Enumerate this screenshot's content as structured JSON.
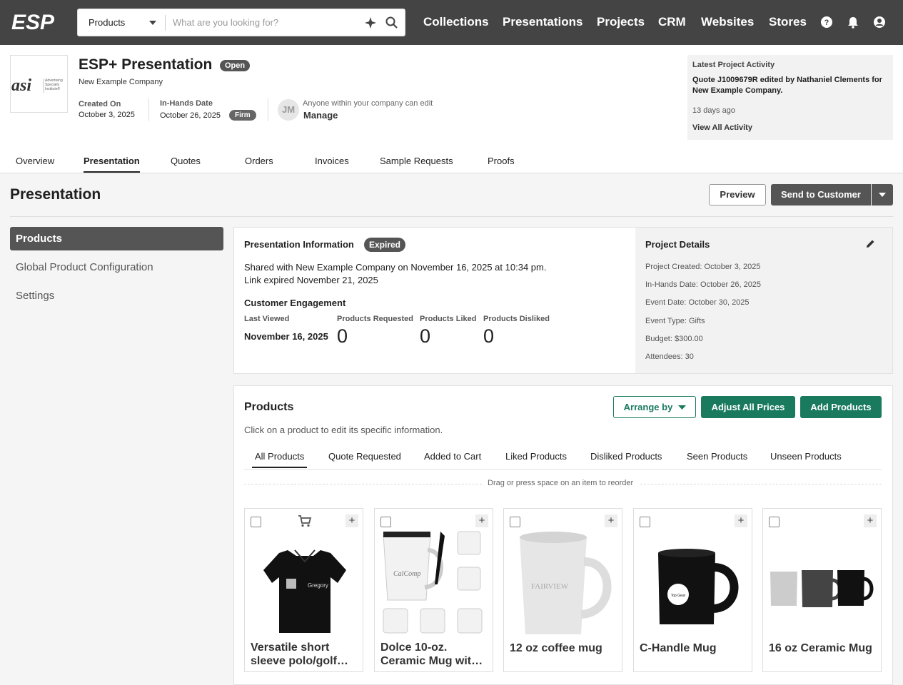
{
  "topbar": {
    "logo_text": "ESP",
    "search_scope": "Products",
    "search_placeholder": "What are you looking for?",
    "nav": [
      "Collections",
      "Presentations",
      "Projects",
      "CRM",
      "Websites",
      "Stores"
    ]
  },
  "project": {
    "title": "ESP+ Presentation",
    "status": "Open",
    "company": "New Example Company",
    "created_label": "Created On",
    "created_value": "October 3, 2025",
    "inhands_label": "In-Hands Date",
    "inhands_value": "October 26, 2025",
    "inhands_badge": "Firm",
    "avatar_initials": "JM",
    "access_note": "Anyone within your company can edit",
    "manage_label": "Manage"
  },
  "activity": {
    "title": "Latest Project Activity",
    "text": "Quote J1009679R edited by Nathaniel Clements for New Example Company.",
    "when": "13 days ago",
    "link": "View All Activity"
  },
  "tabs": [
    "Overview",
    "Presentation",
    "Quotes",
    "Orders",
    "Invoices",
    "Sample Requests",
    "Proofs"
  ],
  "page": {
    "title": "Presentation",
    "preview_label": "Preview",
    "send_label": "Send to Customer"
  },
  "sidebar": [
    "Products",
    "Global Product Configuration",
    "Settings"
  ],
  "info": {
    "title": "Presentation Information",
    "badge": "Expired",
    "shared": "Shared with New Example Company on November 16, 2025 at 10:34 pm.",
    "expired": "Link expired November 21, 2025",
    "engagement_title": "Customer Engagement",
    "last_viewed_label": "Last Viewed",
    "last_viewed_value": "November 16, 2025",
    "requested_label": "Products Requested",
    "requested_value": "0",
    "liked_label": "Products Liked",
    "liked_value": "0",
    "disliked_label": "Products Disliked",
    "disliked_value": "0"
  },
  "details": {
    "title": "Project Details",
    "items": [
      "Project Created: October 3, 2025",
      "In-Hands Date: October 26, 2025",
      "Event Date: October 30, 2025",
      "Event Type: Gifts",
      "Budget: $300.00",
      "Attendees: 30"
    ]
  },
  "products": {
    "title": "Products",
    "subtitle": "Click on a product to edit its specific information.",
    "arrange_label": "Arrange by",
    "adjust_label": "Adjust All Prices",
    "add_label": "Add Products",
    "filters": [
      "All Products",
      "Quote Requested",
      "Added to Cart",
      "Liked Products",
      "Disliked Products",
      "Seen Products",
      "Unseen Products"
    ],
    "drag_hint": "Drag or press space on an item to reorder",
    "items": [
      {
        "name": "Versatile short sleeve polo/golf…",
        "imprint": "Gregory"
      },
      {
        "name": "Dolce 10-oz. Ceramic Mug wit…",
        "imprint": "CalComp"
      },
      {
        "name": "12 oz coffee mug",
        "imprint": "FAIRVIEW"
      },
      {
        "name": "C-Handle Mug",
        "imprint": "Top Gear"
      },
      {
        "name": "16 oz Ceramic Mug",
        "imprint": ""
      }
    ]
  },
  "colors": {
    "accent": "#1a7a5e",
    "topbar": "#444444",
    "dark_button": "#555555"
  }
}
